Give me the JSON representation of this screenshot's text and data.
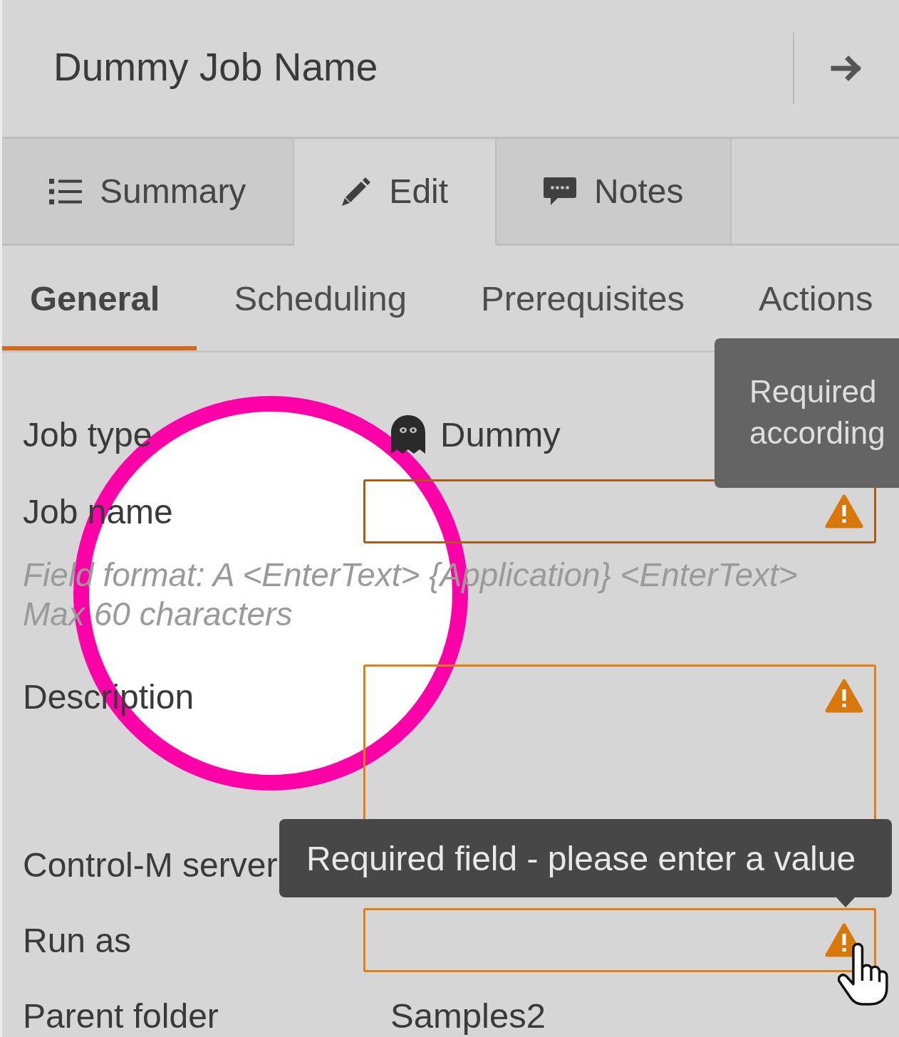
{
  "header": {
    "title": "Dummy Job Name"
  },
  "tabs": [
    {
      "label": "Summary",
      "selected": false
    },
    {
      "label": "Edit",
      "selected": true
    },
    {
      "label": "Notes",
      "selected": false
    }
  ],
  "subtabs": [
    {
      "label": "General",
      "selected": true
    },
    {
      "label": "Scheduling",
      "selected": false
    },
    {
      "label": "Prerequisites",
      "selected": false
    },
    {
      "label": "Actions",
      "selected": false
    }
  ],
  "fields": [
    {
      "kind": "type",
      "label": "Job type",
      "value": "Dummy"
    },
    {
      "kind": "input",
      "label": "Job name",
      "focused": true,
      "invalid": true,
      "hovered": false,
      "hint_lines": [
        "Field format: A <EnterText> {Application} <EnterText>",
        "Max 60 characters"
      ]
    },
    {
      "kind": "textarea",
      "label": "Description",
      "focused": false,
      "invalid": true,
      "hovered": false
    },
    {
      "kind": "text",
      "label": "Control-M server"
    },
    {
      "kind": "input",
      "label": "Run as",
      "focused": false,
      "invalid": true,
      "hovered": true
    },
    {
      "kind": "text",
      "label": "Parent folder",
      "value": "Samples2"
    }
  ],
  "tooltips": [
    {
      "kind": "side",
      "text": "Required according"
    },
    {
      "kind": "pointer",
      "text": "Required field - please enter a value"
    }
  ],
  "highlight": {
    "kind": "ring"
  }
}
